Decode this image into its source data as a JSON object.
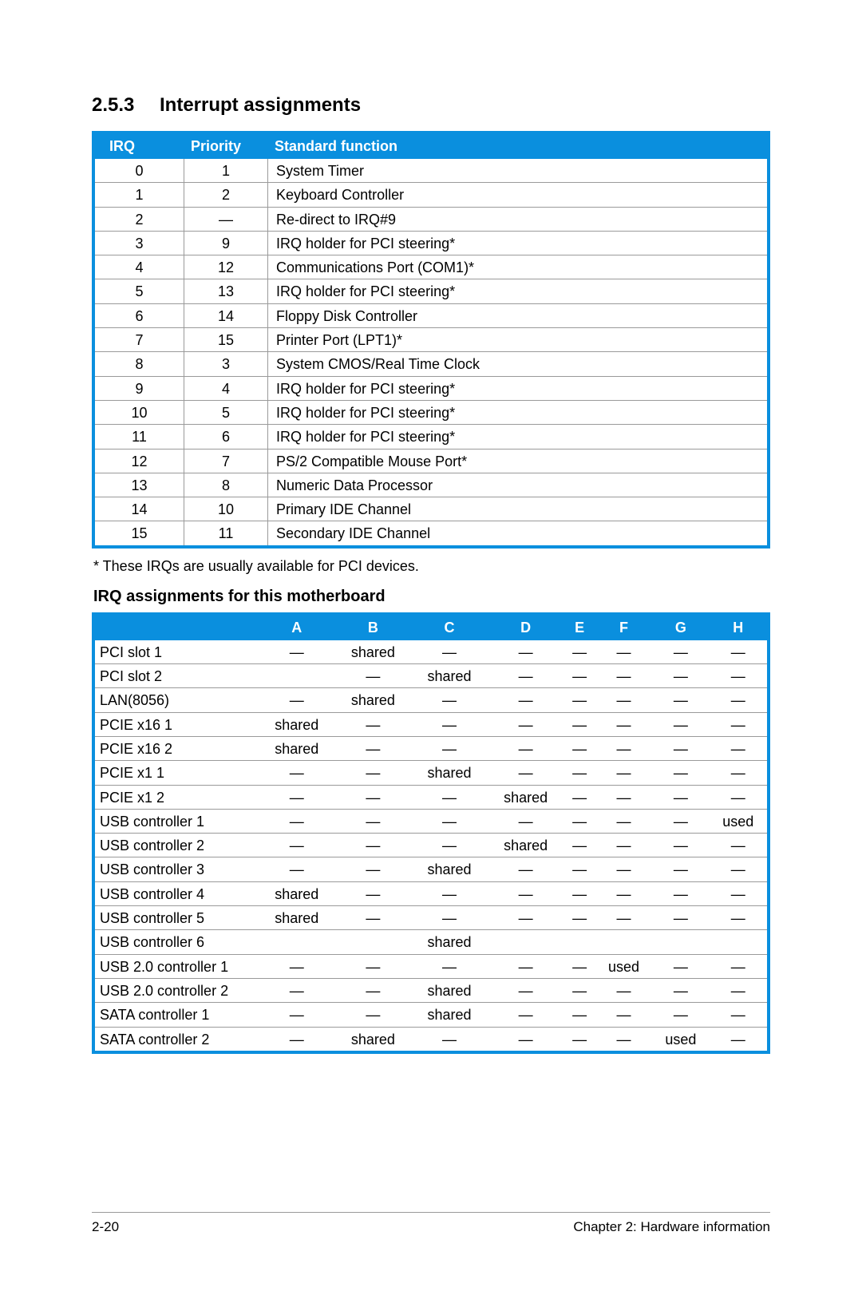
{
  "section": {
    "number": "2.5.3",
    "title": "Interrupt assignments"
  },
  "irq_table": {
    "headers": {
      "irq": "IRQ",
      "priority": "Priority",
      "func": "Standard function"
    },
    "rows": [
      {
        "irq": "0",
        "priority": "1",
        "func": "System Timer"
      },
      {
        "irq": "1",
        "priority": "2",
        "func": "Keyboard Controller"
      },
      {
        "irq": "2",
        "priority": "—",
        "func": "Re-direct to IRQ#9"
      },
      {
        "irq": "3",
        "priority": "9",
        "func": "IRQ holder for PCI steering*"
      },
      {
        "irq": "4",
        "priority": "12",
        "func": "Communications Port (COM1)*"
      },
      {
        "irq": "5",
        "priority": "13",
        "func": "IRQ holder for PCI steering*"
      },
      {
        "irq": "6",
        "priority": "14",
        "func": "Floppy Disk Controller"
      },
      {
        "irq": "7",
        "priority": "15",
        "func": "Printer Port (LPT1)*"
      },
      {
        "irq": "8",
        "priority": "3",
        "func": "System CMOS/Real Time Clock"
      },
      {
        "irq": "9",
        "priority": "4",
        "func": "IRQ holder for PCI steering*"
      },
      {
        "irq": "10",
        "priority": "5",
        "func": "IRQ holder for PCI steering*"
      },
      {
        "irq": "11",
        "priority": "6",
        "func": "IRQ holder for PCI steering*"
      },
      {
        "irq": "12",
        "priority": "7",
        "func": "PS/2 Compatible Mouse Port*"
      },
      {
        "irq": "13",
        "priority": "8",
        "func": "Numeric Data Processor"
      },
      {
        "irq": "14",
        "priority": "10",
        "func": "Primary IDE Channel"
      },
      {
        "irq": "15",
        "priority": "11",
        "func": "Secondary IDE Channel"
      }
    ]
  },
  "footnote": "* These IRQs are usually available for PCI devices.",
  "subheading": "IRQ assignments for this motherboard",
  "mb_table": {
    "cols": [
      "A",
      "B",
      "C",
      "D",
      "E",
      "F",
      "G",
      "H"
    ],
    "rows": [
      {
        "label": "PCI slot 1",
        "v": [
          "—",
          "shared",
          "—",
          "—",
          "—",
          "—",
          "—",
          "—"
        ]
      },
      {
        "label": "PCI slot 2",
        "v": [
          "",
          "—",
          "shared",
          "—",
          "—",
          "—",
          "—",
          "—"
        ]
      },
      {
        "label": "LAN(8056)",
        "v": [
          "—",
          "shared",
          "—",
          "—",
          "—",
          "—",
          "—",
          "—"
        ]
      },
      {
        "label": "PCIE x16 1",
        "v": [
          "shared",
          "—",
          "—",
          "—",
          "—",
          "—",
          "—",
          "—"
        ]
      },
      {
        "label": "PCIE x16 2",
        "v": [
          "shared",
          "—",
          "—",
          "—",
          "—",
          "—",
          "—",
          "—"
        ]
      },
      {
        "label": "PCIE x1 1",
        "v": [
          "—",
          "—",
          "shared",
          "—",
          "—",
          "—",
          "—",
          "—"
        ]
      },
      {
        "label": "PCIE x1 2",
        "v": [
          "—",
          "—",
          "—",
          "shared",
          "—",
          "—",
          "—",
          "—"
        ]
      },
      {
        "label": "USB controller 1",
        "v": [
          "—",
          "—",
          "—",
          "—",
          "—",
          "—",
          "—",
          "used"
        ]
      },
      {
        "label": "USB controller 2",
        "v": [
          "—",
          "—",
          "—",
          "shared",
          "—",
          "—",
          "—",
          "—"
        ]
      },
      {
        "label": "USB controller 3",
        "v": [
          "—",
          "—",
          "shared",
          "—",
          "—",
          "—",
          "—",
          "—"
        ]
      },
      {
        "label": "USB controller 4",
        "v": [
          "shared",
          "—",
          "—",
          "—",
          "—",
          "—",
          "—",
          "—"
        ]
      },
      {
        "label": "USB controller 5",
        "v": [
          "shared",
          "—",
          "—",
          "—",
          "—",
          "—",
          "—",
          "—"
        ]
      },
      {
        "label": "USB controller 6",
        "v": [
          "",
          "",
          "shared",
          "",
          "",
          "",
          "",
          ""
        ]
      },
      {
        "label": "USB 2.0 controller 1",
        "v": [
          "—",
          "—",
          "—",
          "—",
          "—",
          "used",
          "—",
          "—"
        ]
      },
      {
        "label": "USB 2.0 controller 2",
        "v": [
          "—",
          "—",
          "shared",
          "—",
          "—",
          "—",
          "—",
          "—"
        ]
      },
      {
        "label": "SATA controller 1",
        "v": [
          "—",
          "—",
          "shared",
          "—",
          "—",
          "—",
          "—",
          "—"
        ]
      },
      {
        "label": "SATA controller 2",
        "v": [
          "—",
          "shared",
          "—",
          "—",
          "—",
          "—",
          "used",
          "—"
        ]
      }
    ]
  },
  "footer": {
    "left": "2-20",
    "right": "Chapter 2: Hardware information"
  }
}
